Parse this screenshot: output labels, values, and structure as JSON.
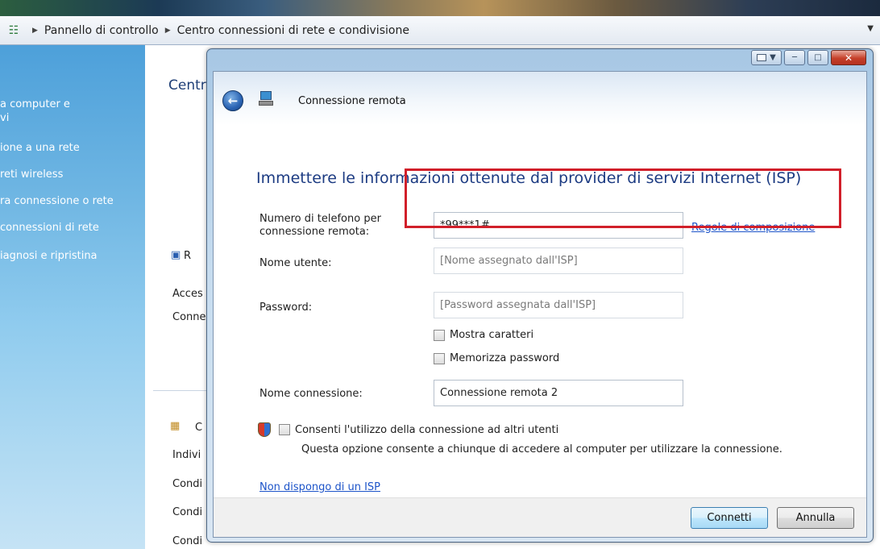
{
  "breadcrumb": {
    "items": [
      "Pannello di controllo",
      "Centro connessioni di rete e condivisione"
    ]
  },
  "left_pane": {
    "items": [
      "a computer e",
      "vi",
      "ione a una rete",
      "reti wireless",
      "ra connessione o rete",
      "connessioni di rete",
      "iagnosi e ripristina"
    ]
  },
  "background": {
    "title": "Centr",
    "fragments": [
      "R",
      "Acces",
      "Conne",
      "C",
      "Indivi",
      "Condi",
      "Condi",
      "Condi"
    ]
  },
  "dialog": {
    "title": "Connessione remota",
    "heading": "Immettere le informazioni ottenute dal provider di servizi Internet (ISP)",
    "phone_label_line1": "Numero di telefono per",
    "phone_label_line2": "connessione remota:",
    "phone_value": "*99***1#",
    "dialing_rules_link": "Regole di composizione",
    "username_label": "Nome utente:",
    "username_placeholder": "[Nome assegnato dall'ISP]",
    "password_label": "Password:",
    "password_placeholder": "[Password assegnata dall'ISP]",
    "show_chars_label": "Mostra caratteri",
    "remember_password_label": "Memorizza password",
    "conn_name_label": "Nome connessione:",
    "conn_name_value": "Connessione remota 2",
    "allow_others_label": "Consenti l'utilizzo della connessione ad altri utenti",
    "allow_others_desc": "Questa opzione consente a chiunque di accedere al computer per utilizzare la connessione.",
    "no_isp_link": "Non dispongo di un ISP",
    "connect_button": "Connetti",
    "cancel_button": "Annulla"
  },
  "colors": {
    "heading": "#1c3b82",
    "link": "#1d54c9",
    "highlight": "#d11f2a"
  }
}
